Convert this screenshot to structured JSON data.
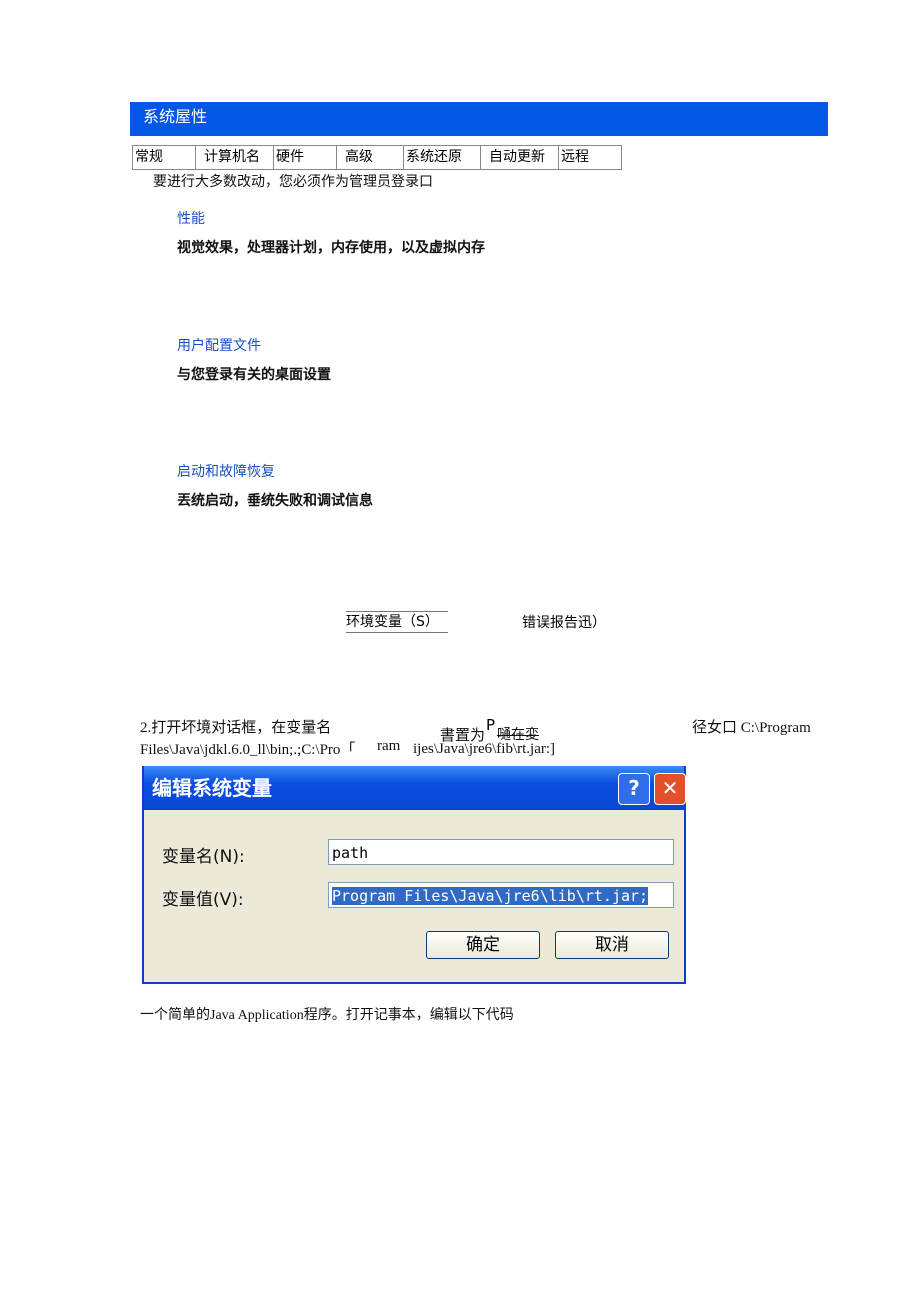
{
  "header": {
    "title": "系统屋性"
  },
  "tabs": [
    "常规",
    "计算机名",
    "硬件",
    "高级",
    "系统还原",
    "自动更新",
    "远程"
  ],
  "notice": "要进行大多数改动，您必须作为管理员登录口",
  "sections": [
    {
      "heading": "性能",
      "desc": "视觉效果，处理器计划，内存使用，以及虚拟内存"
    },
    {
      "heading": "用户配置文件",
      "desc": "与您登录有关的桌面设置"
    },
    {
      "heading": "启动和故障恢复",
      "desc": "丟统启动，垂统失败和调试信息"
    }
  ],
  "buttons": {
    "env": "环境变量（S）",
    "error": "错误报告迅）"
  },
  "step": {
    "line1_a": "2.打开坏境对话框，在变量名",
    "line1_mid": "書置为",
    "line1_p": "P",
    "line1_strike": "嗵在変",
    "line1_b": "径女口  C:\\Program",
    "line2_a": "Files\\Java\\jdkl.6.0_ll\\bin;.;C:\\Pro「",
    "line2_b": "ram",
    "line2_c": "ijes\\Java\\jre6\\fib\\rt.jar:]"
  },
  "dialog": {
    "title": "编辑系统变量",
    "help": "?",
    "close": "✕",
    "name_label": "变量名(N):",
    "name_value": "path",
    "value_label": "变量值(V):",
    "value_value": "Program Files\\Java\\jre6\\lib\\rt.jar;",
    "ok": "确定",
    "cancel": "取消"
  },
  "footer": "一个简单的Java Application程序。打开记事本，编辑以下代码"
}
